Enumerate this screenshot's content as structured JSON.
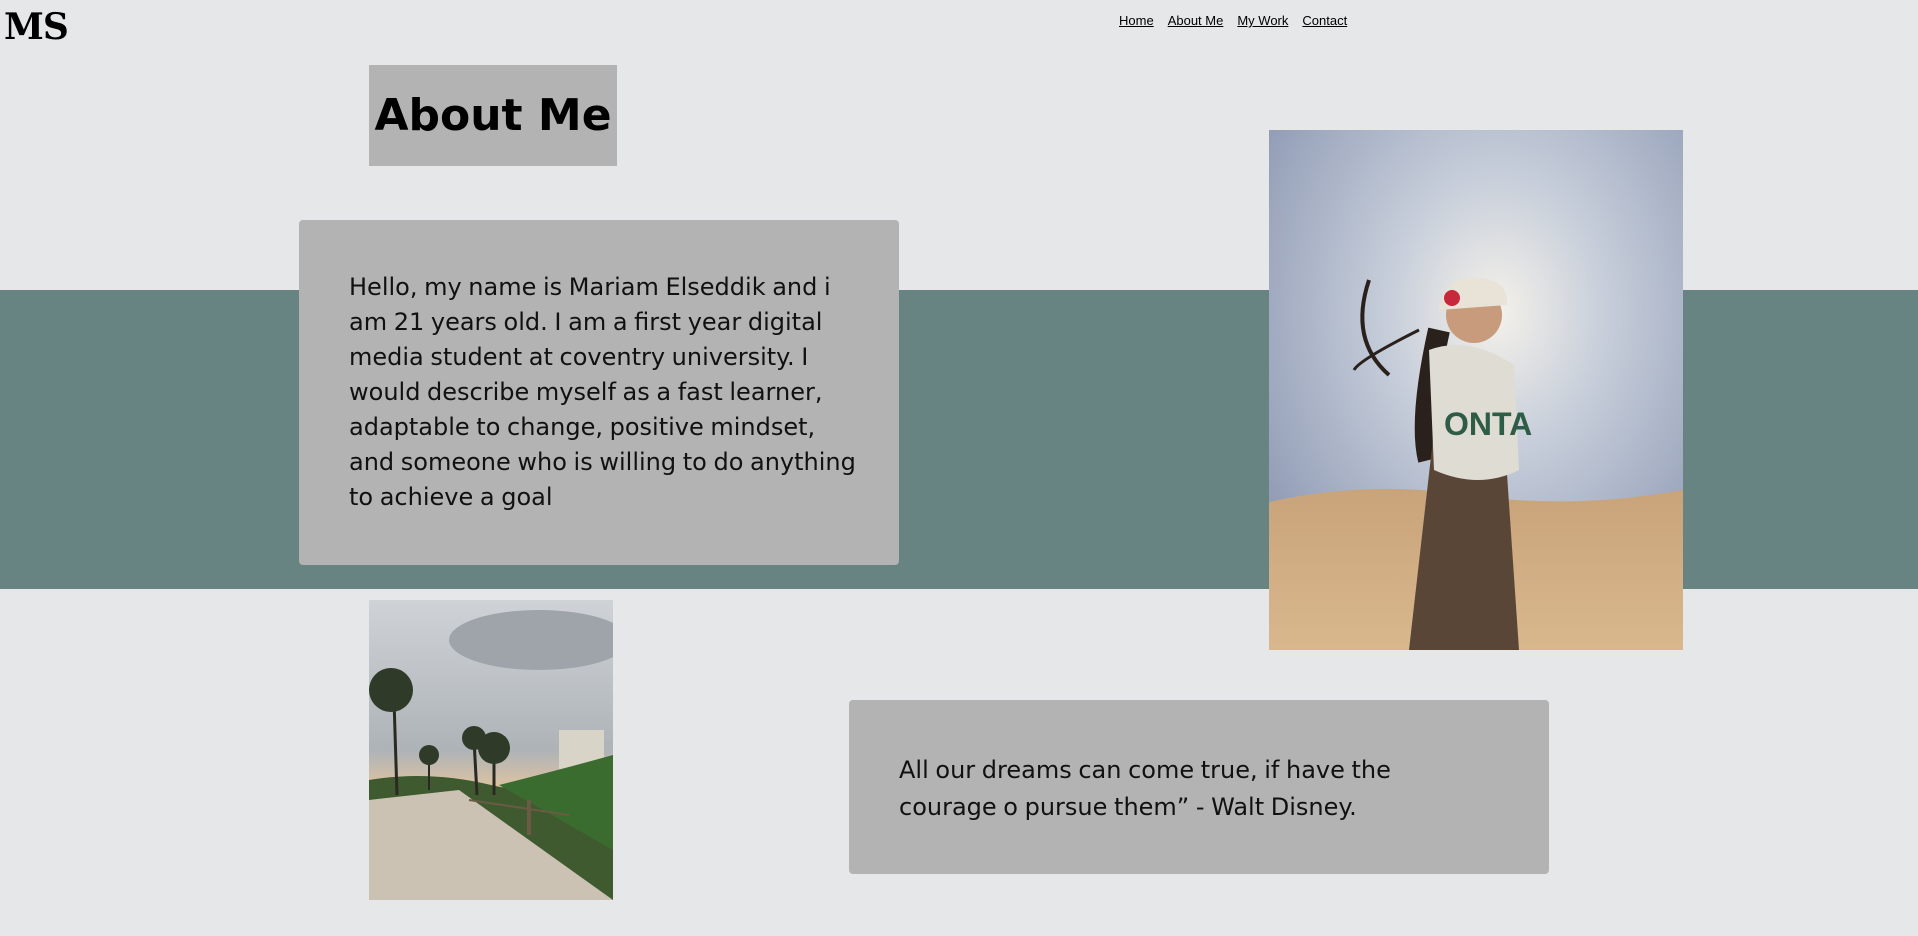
{
  "header": {
    "logo": "MS",
    "nav": [
      "Home",
      "About Me",
      "My Work",
      "Contact"
    ]
  },
  "main": {
    "title": "About Me",
    "bio": "Hello, my name is Mariam Elseddik and i am 21 years old. I am a first year digital media student at coventry university. I would describe myself as a fast learner, adaptable to change, positive mindset, and someone who is willing to do anything to achieve a goal",
    "quote": "All our dreams can come true, if have the courage o pursue them” - Walt Disney."
  },
  "images": {
    "portrait": "photo of woman in cap on desert dunes",
    "beach_path": "photo of sandy path with palm trees"
  },
  "colors": {
    "background": "#e6e7e9",
    "band": "#678483",
    "card": "#b3b3b3"
  }
}
